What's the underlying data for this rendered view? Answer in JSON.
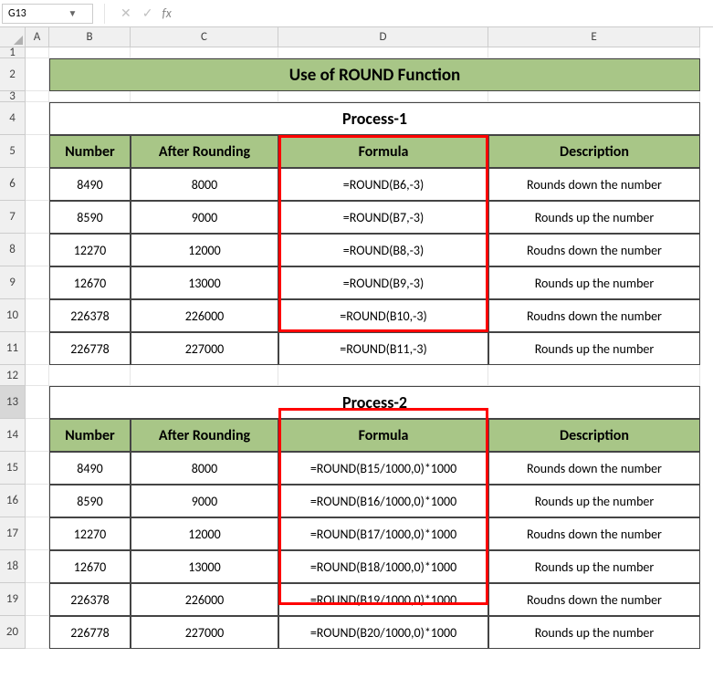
{
  "namebox": "G13",
  "fx": "fx",
  "title": "Use of ROUND Function",
  "colHeaders": [
    "A",
    "B",
    "C",
    "D",
    "E"
  ],
  "rowHeaders": [
    "1",
    "2",
    "3",
    "4",
    "5",
    "6",
    "7",
    "8",
    "9",
    "10",
    "11",
    "12",
    "13",
    "14",
    "15",
    "16",
    "17",
    "18",
    "19",
    "20"
  ],
  "p1": {
    "title": "Process-1",
    "cols": [
      "Number",
      "After Rounding",
      "Formula",
      "Description"
    ],
    "rows": [
      {
        "n": "8490",
        "a": "8000",
        "f": "=ROUND(B6,-3)",
        "d": "Rounds down the number"
      },
      {
        "n": "8590",
        "a": "9000",
        "f": "=ROUND(B7,-3)",
        "d": "Rounds up the number"
      },
      {
        "n": "12270",
        "a": "12000",
        "f": "=ROUND(B8,-3)",
        "d": "Roudns down the number"
      },
      {
        "n": "12670",
        "a": "13000",
        "f": "=ROUND(B9,-3)",
        "d": "Rounds up the number"
      },
      {
        "n": "226378",
        "a": "226000",
        "f": "=ROUND(B10,-3)",
        "d": "Roudns down the number"
      },
      {
        "n": "226778",
        "a": "227000",
        "f": "=ROUND(B11,-3)",
        "d": "Rounds up the number"
      }
    ]
  },
  "p2": {
    "title": "Process-2",
    "cols": [
      "Number",
      "After Rounding",
      "Formula",
      "Description"
    ],
    "rows": [
      {
        "n": "8490",
        "a": "8000",
        "f": "=ROUND(B15/1000,0)*1000",
        "d": "Rounds down the number"
      },
      {
        "n": "8590",
        "a": "9000",
        "f": "=ROUND(B16/1000,0)*1000",
        "d": "Rounds up the number"
      },
      {
        "n": "12270",
        "a": "12000",
        "f": "=ROUND(B17/1000,0)*1000",
        "d": "Roudns down the number"
      },
      {
        "n": "12670",
        "a": "13000",
        "f": "=ROUND(B18/1000,0)*1000",
        "d": "Rounds up the number"
      },
      {
        "n": "226378",
        "a": "226000",
        "f": "=ROUND(B19/1000,0)*1000",
        "d": "Roudns down the number"
      },
      {
        "n": "226778",
        "a": "227000",
        "f": "=ROUND(B20/1000,0)*1000",
        "d": "Rounds up the number"
      }
    ]
  }
}
